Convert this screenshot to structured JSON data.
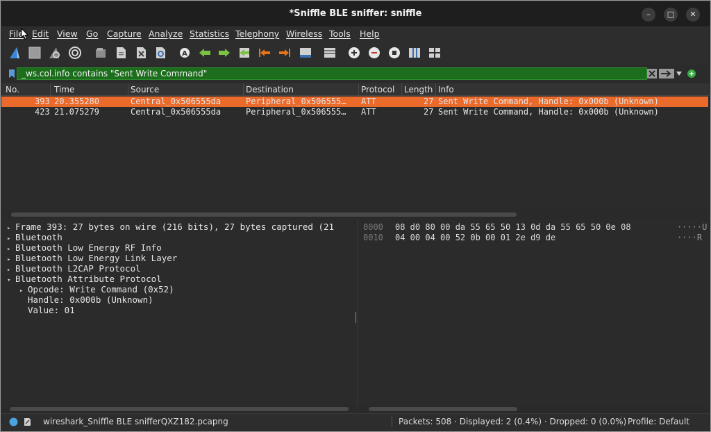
{
  "window": {
    "title": "*Sniffle BLE sniffer: sniffle",
    "minimize_glyph": "–",
    "maximize_glyph": "□",
    "close_glyph": "✕"
  },
  "menu": [
    "File",
    "Edit",
    "View",
    "Go",
    "Capture",
    "Analyze",
    "Statistics",
    "Telephony",
    "Wireless",
    "Tools",
    "Help"
  ],
  "toolbar": {
    "icons": [
      "shark-fin-start-icon",
      "stop-square-icon",
      "restart-fin-icon",
      "capture-options-icon",
      "open-folder-icon",
      "save-file-icon",
      "close-file-icon",
      "reload-icon",
      "find-packet-icon",
      "go-back-arrow-icon",
      "go-forward-arrow-icon",
      "go-to-packet-icon",
      "first-packet-icon",
      "last-packet-icon",
      "autoscroll-icon",
      "colorize-icon",
      "zoom-in-icon",
      "zoom-out-icon",
      "zoom-normal-icon",
      "resize-columns-icon",
      "layout-icon"
    ]
  },
  "filter": {
    "value": "_ws.col.info contains \"Sent Write Command\"",
    "accent": "#1c6e1c"
  },
  "packet_list": {
    "columns": [
      "No.",
      "Time",
      "Source",
      "Destination",
      "Protocol",
      "Length",
      "Info"
    ],
    "rows": [
      {
        "no": "393",
        "time": "20.355280",
        "source": "Central_0x506555da",
        "destination": "Peripheral_0x506555…",
        "protocol": "ATT",
        "length": "27",
        "info": "Sent Write Command, Handle: 0x000b (Unknown)",
        "selected": true
      },
      {
        "no": "423",
        "time": "21.075279",
        "source": "Central_0x506555da",
        "destination": "Peripheral_0x506555…",
        "protocol": "ATT",
        "length": "27",
        "info": "Sent Write Command, Handle: 0x000b (Unknown)",
        "selected": false
      }
    ],
    "selected_color": "#ea6a2c"
  },
  "details": [
    {
      "indent": 0,
      "arrow": "▸",
      "text": "Frame 393: 27 bytes on wire (216 bits), 27 bytes captured (21"
    },
    {
      "indent": 0,
      "arrow": "▸",
      "text": "Bluetooth"
    },
    {
      "indent": 0,
      "arrow": "▸",
      "text": "Bluetooth Low Energy RF Info"
    },
    {
      "indent": 0,
      "arrow": "▸",
      "text": "Bluetooth Low Energy Link Layer"
    },
    {
      "indent": 0,
      "arrow": "▸",
      "text": "Bluetooth L2CAP Protocol"
    },
    {
      "indent": 0,
      "arrow": "▾",
      "text": "Bluetooth Attribute Protocol"
    },
    {
      "indent": 1,
      "arrow": "▸",
      "text": "Opcode: Write Command (0x52)"
    },
    {
      "indent": 1,
      "arrow": "",
      "text": "Handle: 0x000b (Unknown)"
    },
    {
      "indent": 1,
      "arrow": "",
      "text": "Value: 01"
    }
  ],
  "hex": [
    {
      "offset": "0000",
      "bytes": "08 d0 80 00 da 55 65 50  13 0d da 55 65 50 0e 08",
      "ascii": "·····U"
    },
    {
      "offset": "0010",
      "bytes": "04 00 04 00 52 0b 00 01  2e d9 de",
      "ascii": "····R"
    }
  ],
  "status": {
    "file": "wireshark_Sniffle BLE snifferQXZ182.pcapng",
    "packets": "Packets: 508 · Displayed: 2 (0.4%) · Dropped: 0 (0.0%)",
    "profile": "Profile: Default"
  }
}
